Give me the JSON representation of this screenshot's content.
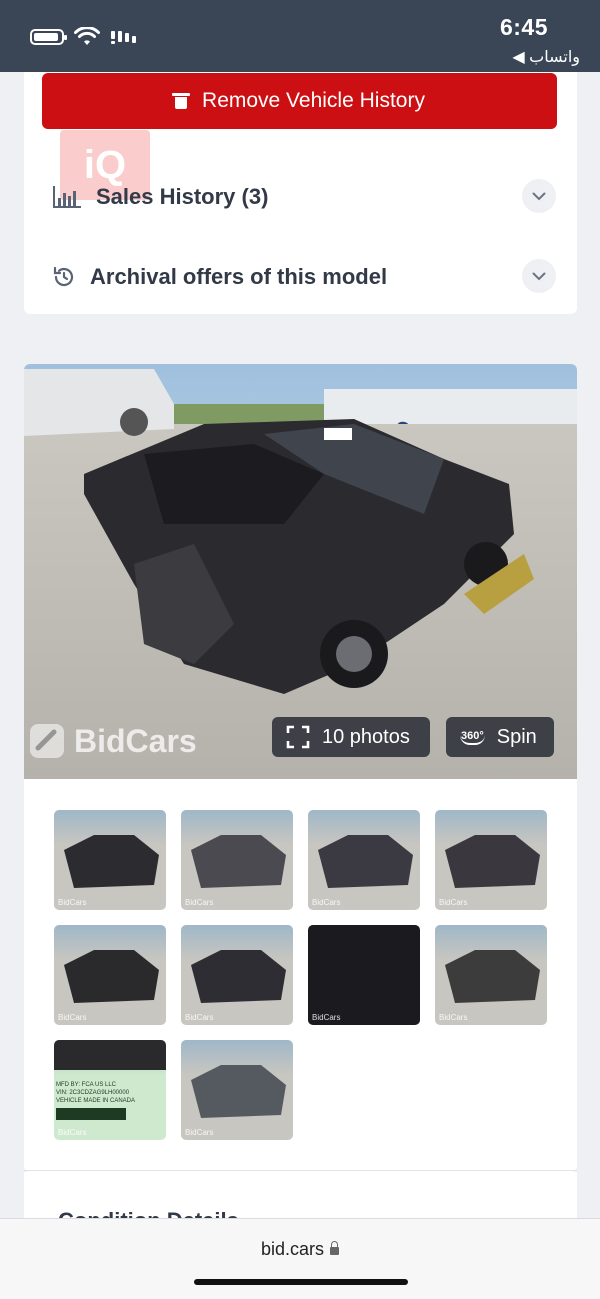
{
  "status_bar": {
    "time": "6:45",
    "back_app": "◀ واتساب",
    "icons": [
      "battery-icon",
      "wifi-icon",
      "signal-icon"
    ]
  },
  "vehicle_history": {
    "remove_button": "Remove Vehicle History",
    "watermark": "iQ",
    "sections": [
      {
        "label": "Sales History (3)",
        "icon": "bar-chart-icon"
      },
      {
        "label": "Archival offers of this model",
        "icon": "history-icon"
      }
    ]
  },
  "gallery": {
    "watermark": "BidCars",
    "photos_button": "10 photos",
    "spin_badge": "360°",
    "spin_button": "Spin",
    "photo_count": 10,
    "thumbnails": [
      {
        "label": "BidCars",
        "subject": "front damage",
        "accent": "#2b2b30"
      },
      {
        "label": "BidCars",
        "subject": "front damage faded",
        "accent": "#4a4a50"
      },
      {
        "label": "BidCars",
        "subject": "rear left",
        "accent": "#3b3a42"
      },
      {
        "label": "BidCars",
        "subject": "rear right",
        "accent": "#3a383e"
      },
      {
        "label": "BidCars",
        "subject": "interior front",
        "accent": "#2a2a2c"
      },
      {
        "label": "BidCars",
        "subject": "front",
        "accent": "#2d2d33"
      },
      {
        "label": "BidCars",
        "subject": "dashboard",
        "accent": "#1a1a1f"
      },
      {
        "label": "BidCars",
        "subject": "rear seats",
        "accent": "#3c3c3c"
      },
      {
        "label": "BidCars",
        "subject": "vin label",
        "accent": "#8fd89a"
      },
      {
        "label": "BidCars",
        "subject": "engine",
        "accent": "#555a60"
      }
    ],
    "vin_text": [
      "MFD BY: FCA US LLC",
      "VIN: 2C3CDZAG9LH00000",
      "VEHICLE MADE IN CANADA"
    ]
  },
  "next_section_peek": "Condition Details",
  "browser": {
    "url": "bid.cars"
  },
  "colors": {
    "remove_red": "#cc0f12",
    "status_bar_bg": "#3a4656",
    "page_bg": "#eef0f3"
  }
}
